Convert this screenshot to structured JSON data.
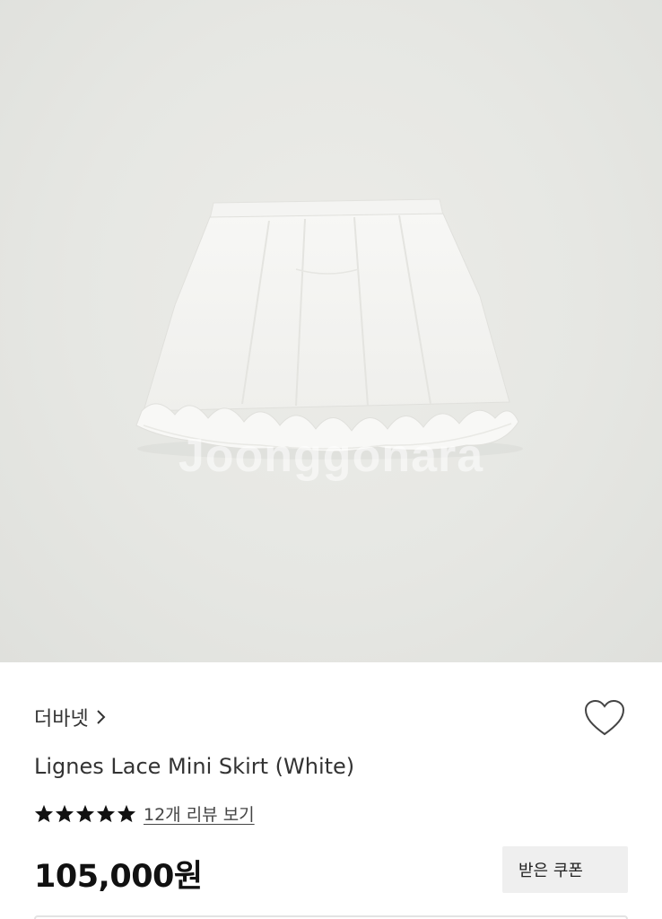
{
  "product_image": {
    "alt": "Lignes Lace Mini Skirt (White)",
    "watermark": "Joonggonara",
    "background_color": "#e6e7e3"
  },
  "brand": {
    "name": "더바넷",
    "chevron_icon": "chevron-right-icon"
  },
  "wishlist": {
    "icon": "heart-outline-icon"
  },
  "product": {
    "title": "Lignes Lace Mini Skirt (White)"
  },
  "rating": {
    "stars": 5,
    "star_color": "#111111",
    "review_link": "12개 리뷰 보기"
  },
  "price": {
    "value": "105,000원"
  },
  "coupon": {
    "label": "받은 쿠폰"
  }
}
